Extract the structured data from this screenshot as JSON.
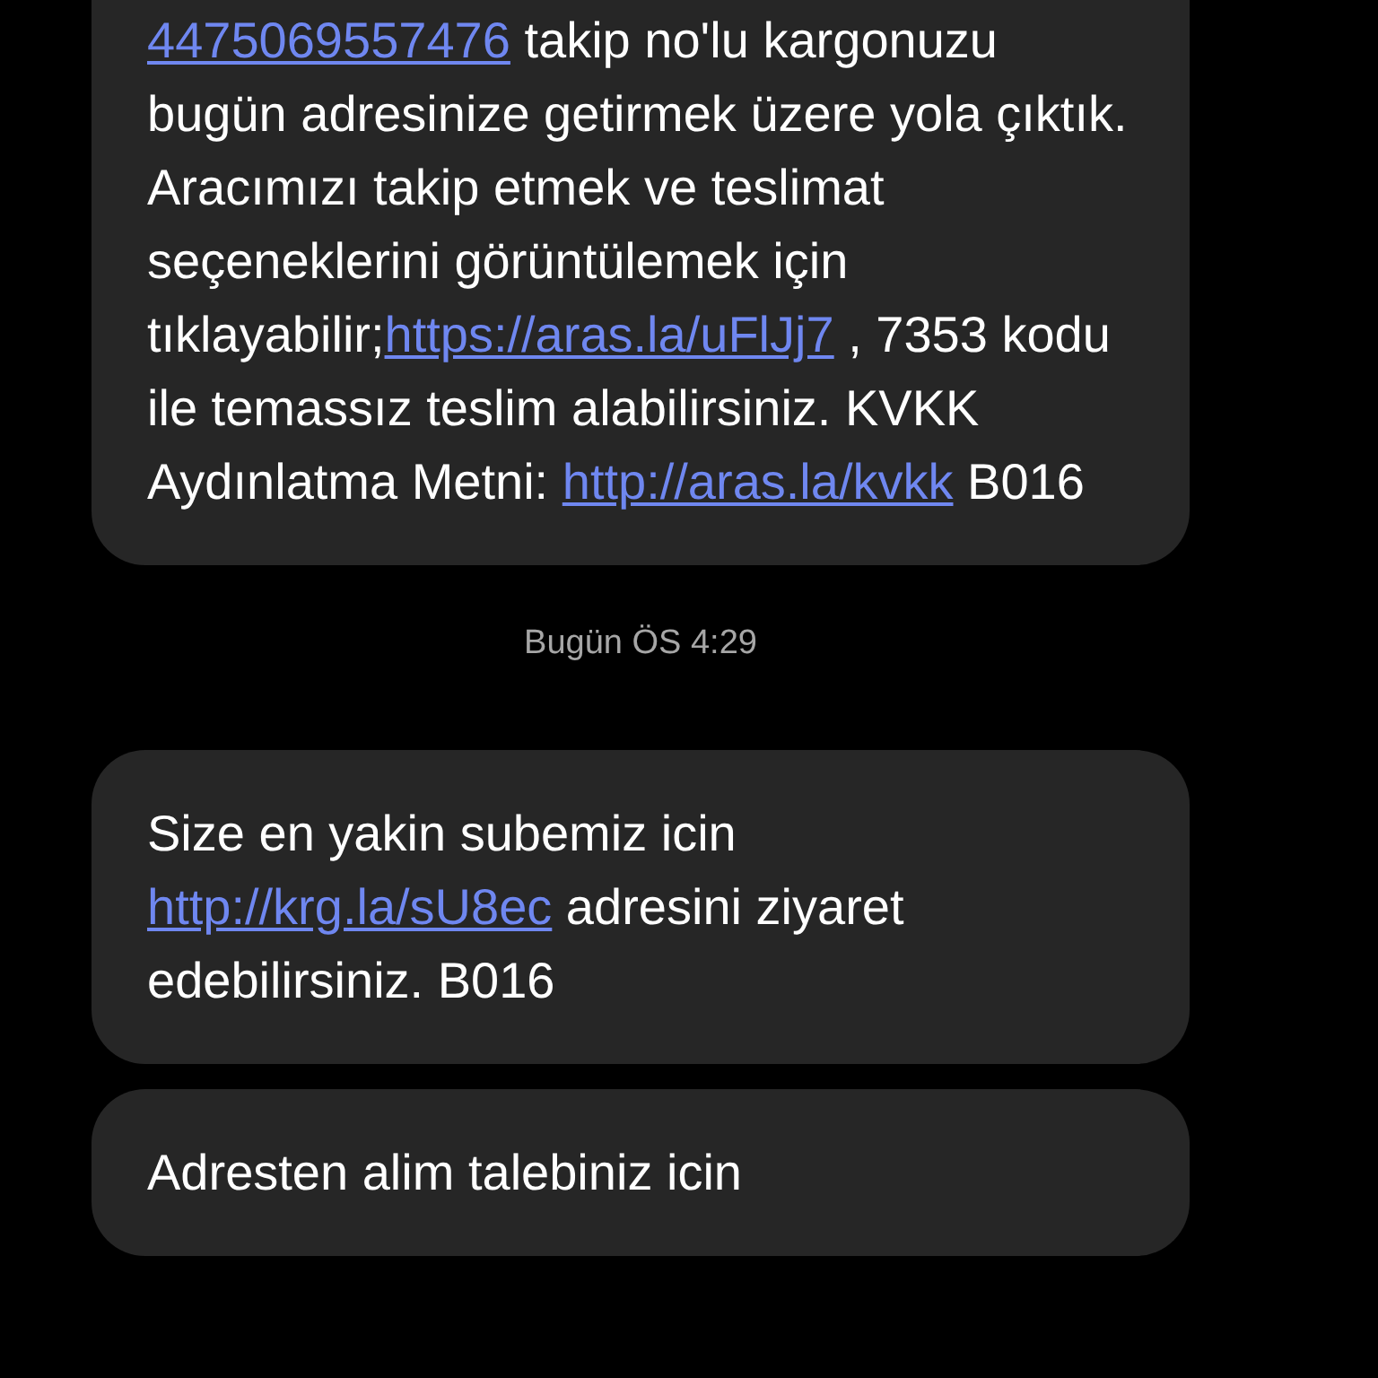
{
  "messages": [
    {
      "parts": [
        {
          "kind": "link",
          "text": "4475069557476"
        },
        {
          "kind": "text",
          "text": " takip no'lu kargonuzu bugün adresinize getirmek üzere yola çıktık. Aracımızı takip etmek ve teslimat seçeneklerini görüntülemek için tıklayabilir;"
        },
        {
          "kind": "link",
          "text": "https://aras.la/uFlJj7"
        },
        {
          "kind": "text",
          "text": " , 7353 kodu ile temassız teslim alabilirsiniz. KVKK Aydınlatma Metni: "
        },
        {
          "kind": "link",
          "text": "http://aras.la/kvkk"
        },
        {
          "kind": "text",
          "text": " B016"
        }
      ]
    },
    {
      "timestamp": "Bugün ÖS 4:29"
    },
    {
      "parts": [
        {
          "kind": "text",
          "text": "Size en yakin subemiz icin "
        },
        {
          "kind": "link",
          "text": "http://krg.la/sU8ec"
        },
        {
          "kind": "text",
          "text": " adresini ziyaret edebilirsiniz. B016"
        }
      ]
    },
    {
      "parts": [
        {
          "kind": "text",
          "text": "Adresten alim talebiniz icin"
        }
      ]
    }
  ]
}
